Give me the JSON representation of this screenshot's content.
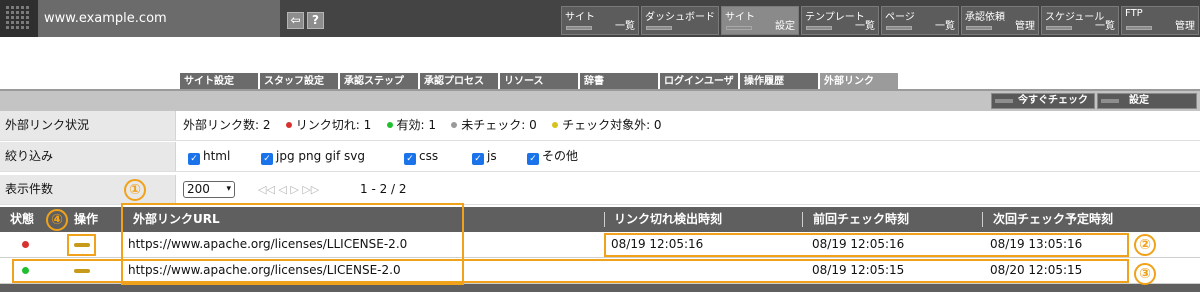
{
  "header": {
    "site_name": "www.example.com",
    "icons": [
      {
        "name": "back-icon",
        "glyph": "⇦"
      },
      {
        "name": "help-icon",
        "glyph": "?"
      }
    ],
    "menu": [
      {
        "top": "サイト",
        "link": "一覧",
        "active": false
      },
      {
        "top": "ダッシュボード",
        "link": "",
        "active": false
      },
      {
        "top": "サイト",
        "link": "設定",
        "active": true
      },
      {
        "top": "テンプレート",
        "link": "一覧",
        "active": false
      },
      {
        "top": "ページ",
        "link": "一覧",
        "active": false
      },
      {
        "top": "承認依頼",
        "link": "管理",
        "active": false
      },
      {
        "top": "スケジュール",
        "link": "一覧",
        "active": false
      },
      {
        "top": "FTP",
        "link": "管理",
        "active": false
      }
    ]
  },
  "tabs": [
    {
      "label": "サイト設定",
      "active": false
    },
    {
      "label": "スタッフ設定",
      "active": false
    },
    {
      "label": "承認ステップ",
      "active": false
    },
    {
      "label": "承認プロセス",
      "active": false
    },
    {
      "label": "リソース",
      "active": false
    },
    {
      "label": "辞書",
      "active": false
    },
    {
      "label": "ログインユーザ",
      "active": false
    },
    {
      "label": "操作履歴",
      "active": false
    },
    {
      "label": "外部リンク",
      "active": true
    }
  ],
  "actions": {
    "check_now": "今すぐチェック",
    "settings": "設定"
  },
  "status": {
    "label": "外部リンク状況",
    "total": "外部リンク数: 2",
    "broken": "リンク切れ: 1",
    "valid": "有効: 1",
    "unchecked": "未チェック: 0",
    "excluded": "チェック対象外: 0",
    "colors": {
      "broken": "#d8322f",
      "valid": "#1fbf2e",
      "unchecked": "#9a9a9a",
      "excluded": "#d6c21a"
    }
  },
  "filter": {
    "label": "絞り込み",
    "options": [
      "html",
      "jpg png gif svg",
      "css",
      "js",
      "その他"
    ],
    "checked": [
      true,
      true,
      true,
      true,
      true
    ]
  },
  "paging": {
    "label": "表示件数",
    "per_page": "200",
    "pager_glyphs": "◁◁  ◁    ▷  ▷▷",
    "range": "1 - 2  /  2"
  },
  "table": {
    "headers": {
      "status": "状態",
      "operation": "操作",
      "url": "外部リンクURL",
      "detected": "リンク切れ検出時刻",
      "last": "前回チェック時刻",
      "next": "次回チェック予定時刻"
    },
    "rows": [
      {
        "status_color": "#d8322f",
        "url": "https://www.apache.org/licenses/LLICENSE-2.0",
        "detected": "08/19 12:05:16",
        "last": "08/19 12:05:16",
        "next": "08/19 13:05:16"
      },
      {
        "status_color": "#1fbf2e",
        "url": "https://www.apache.org/licenses/LICENSE-2.0",
        "detected": "",
        "last": "08/19 12:05:15",
        "next": "08/20 12:05:15"
      }
    ]
  },
  "annotations": {
    "color": "#f0a21a",
    "markers": [
      "①",
      "②",
      "③",
      "④"
    ]
  }
}
